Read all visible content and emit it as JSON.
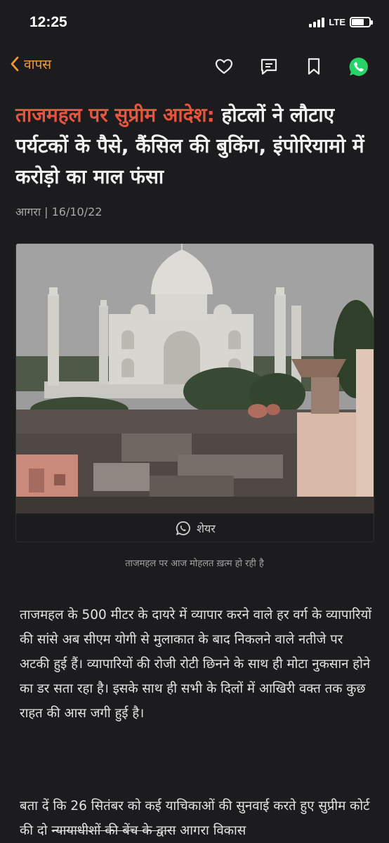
{
  "status_bar": {
    "time": "12:25",
    "network": "LTE",
    "battery_level": 0.7
  },
  "nav": {
    "back_label": "वापस",
    "icons": [
      "heart-icon",
      "comment-icon",
      "bookmark-icon",
      "whatsapp-icon"
    ]
  },
  "article": {
    "headline_highlight": "ताजमहल पर सुप्रीम आदेश:",
    "headline_rest": " होटलों ने लौटाए पर्यटकों के पैसे, कैंसिल की बुकिंग, इंपोरियामो में करोड़ो का माल फंसा",
    "byline": "आगरा | 16/10/22",
    "share_label": "शेयर",
    "image_caption": "ताजमहल पर आज मोहलत  ख़त्म हो रही है",
    "paragraph1": "ताजमहल के 500 मीटर के दायरे में व्यापार करने वाले हर वर्ग के व्यापारियों की सांसे अब सीएम योगी से मुलाकात के बाद निकलने वाले नतीजे पर अटकी हुई हैं। व्यापारियों की रोजी रोटी छिनने के साथ ही मोटा नुकसान होने का डर सता रहा है। इसके साथ ही सभी के दिलों में आखिरी वक्त तक कुछ राहत की आस जगी हुई है।",
    "paragraph2_part1": "बता दें कि 26 सितंबर को कई याचिकाओं की सुनवाई करते हुए सुप्रीम कोर्ट की दो ",
    "paragraph2_struck": "न्यायाधीशों की बेंच के द्वारा",
    "paragraph2_part2": " आगरा विकास"
  },
  "colors": {
    "background": "#1c1c1e",
    "accent_orange": "#f29a3a",
    "headline_red": "#e8553f",
    "whatsapp_green": "#25d366"
  }
}
